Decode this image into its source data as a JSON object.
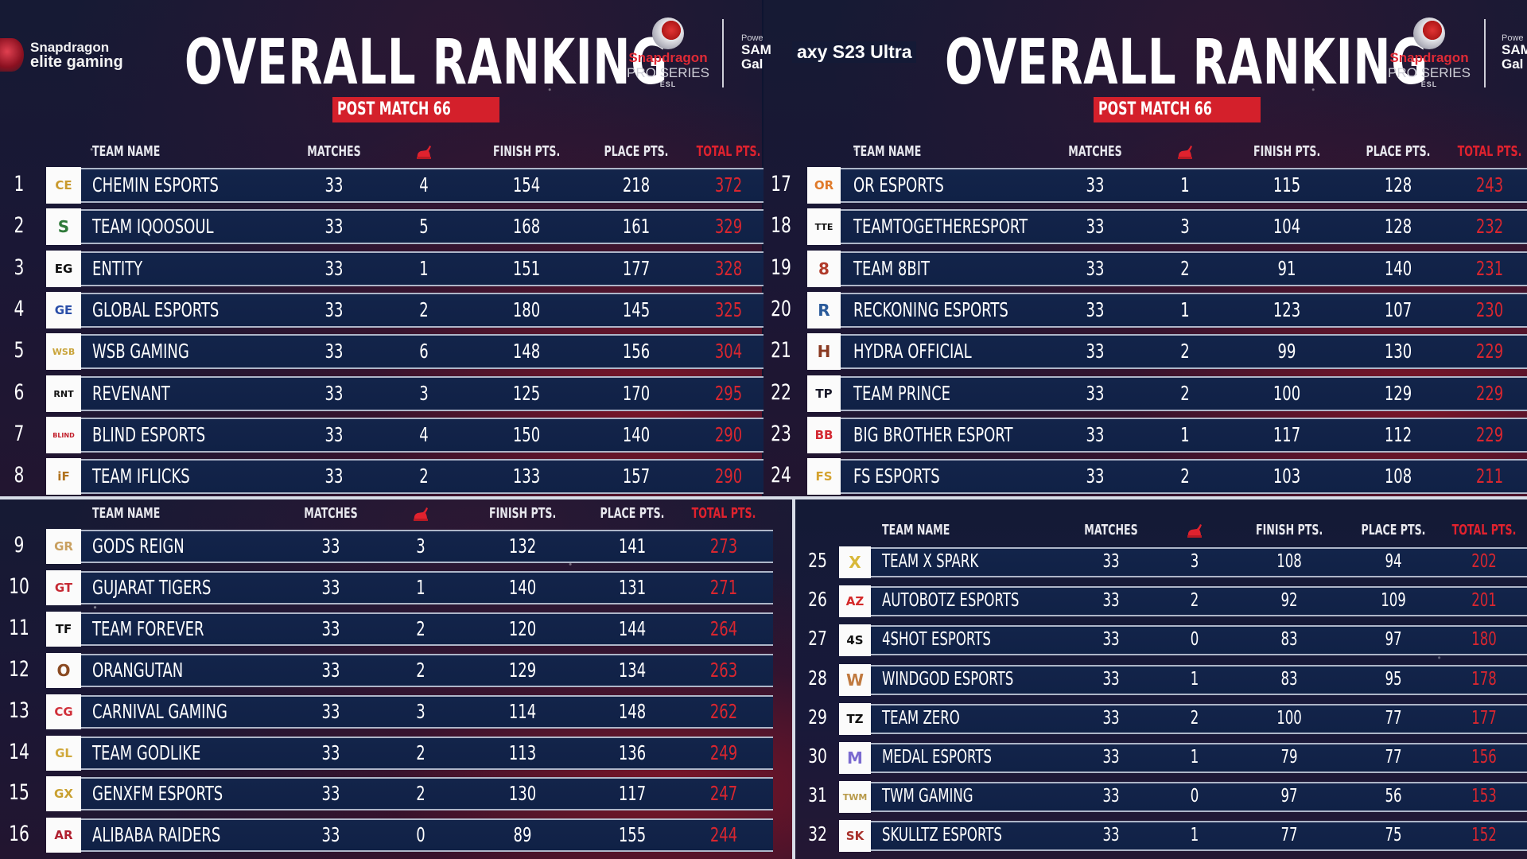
{
  "branding": {
    "left_logo_line1": "Snapdragon",
    "left_logo_line2": "elite gaming",
    "series_line1": "Snapdragon",
    "series_line2": "PRO SERIES",
    "series_line3": "ESL",
    "powered_by": "Powe",
    "powered_brand_l1": "SAM",
    "powered_brand_l2": "Gal",
    "overlay_text": "axy S23 Ultra",
    "colors": {
      "accent_red": "#d4202b",
      "row_bar": "#13244a",
      "background": "#161a34"
    }
  },
  "panels": [
    {
      "title": "OVERALL RANKING",
      "subtitle": "POST MATCH 66"
    },
    {
      "title": "OVERALL RANKING",
      "subtitle": "POST MATCH 66"
    }
  ],
  "columns": {
    "team_name": "TEAM NAME",
    "matches": "MATCHES",
    "wins_icon": "chicken-dinner-icon",
    "finish_pts": "FINISH PTS.",
    "place_pts": "PLACE PTS.",
    "total_pts": "TOTAL PTS."
  },
  "tables": [
    {
      "rows": [
        {
          "rank": "1",
          "team": "CHEMIN ESPORTS",
          "logo": "CE",
          "logo_color": "#c99a2e",
          "matches": "33",
          "wins": "4",
          "finish": "154",
          "place": "218",
          "total": "372"
        },
        {
          "rank": "2",
          "team": "TEAM IQOOSOUL",
          "logo": "S",
          "logo_color": "#2f7a3a",
          "matches": "33",
          "wins": "5",
          "finish": "168",
          "place": "161",
          "total": "329"
        },
        {
          "rank": "3",
          "team": "ENTITY",
          "logo": "EG",
          "logo_color": "#111111",
          "matches": "33",
          "wins": "1",
          "finish": "151",
          "place": "177",
          "total": "328"
        },
        {
          "rank": "4",
          "team": "GLOBAL ESPORTS",
          "logo": "GE",
          "logo_color": "#2a4ea8",
          "matches": "33",
          "wins": "2",
          "finish": "180",
          "place": "145",
          "total": "325"
        },
        {
          "rank": "5",
          "team": "WSB GAMING",
          "logo": "WSB",
          "logo_color": "#c9a43a",
          "matches": "33",
          "wins": "6",
          "finish": "148",
          "place": "156",
          "total": "304"
        },
        {
          "rank": "6",
          "team": "REVENANT",
          "logo": "RNT",
          "logo_color": "#111111",
          "matches": "33",
          "wins": "3",
          "finish": "125",
          "place": "170",
          "total": "295"
        },
        {
          "rank": "7",
          "team": "BLIND ESPORTS",
          "logo": "BLIND",
          "logo_color": "#c21e2a",
          "matches": "33",
          "wins": "4",
          "finish": "150",
          "place": "140",
          "total": "290"
        },
        {
          "rank": "8",
          "team": "TEAM IFLICKS",
          "logo": "iF",
          "logo_color": "#b0721e",
          "matches": "33",
          "wins": "2",
          "finish": "133",
          "place": "157",
          "total": "290"
        }
      ]
    },
    {
      "rows": [
        {
          "rank": "17",
          "team": "OR ESPORTS",
          "logo": "OR",
          "logo_color": "#e07a2a",
          "matches": "33",
          "wins": "1",
          "finish": "115",
          "place": "128",
          "total": "243"
        },
        {
          "rank": "18",
          "team": "TEAMTOGETHERESPORT",
          "logo": "TTE",
          "logo_color": "#111111",
          "matches": "33",
          "wins": "3",
          "finish": "104",
          "place": "128",
          "total": "232"
        },
        {
          "rank": "19",
          "team": "TEAM 8BIT",
          "logo": "8",
          "logo_color": "#b03a2a",
          "matches": "33",
          "wins": "2",
          "finish": "91",
          "place": "140",
          "total": "231"
        },
        {
          "rank": "20",
          "team": "RECKONING ESPORTS",
          "logo": "R",
          "logo_color": "#2a5a9a",
          "matches": "33",
          "wins": "1",
          "finish": "123",
          "place": "107",
          "total": "230"
        },
        {
          "rank": "21",
          "team": "HYDRA OFFICIAL",
          "logo": "H",
          "logo_color": "#8a3a22",
          "matches": "33",
          "wins": "2",
          "finish": "99",
          "place": "130",
          "total": "229"
        },
        {
          "rank": "22",
          "team": "TEAM PRINCE",
          "logo": "TP",
          "logo_color": "#1a1a2a",
          "matches": "33",
          "wins": "2",
          "finish": "100",
          "place": "129",
          "total": "229"
        },
        {
          "rank": "23",
          "team": "BIG BROTHER ESPORT",
          "logo": "BB",
          "logo_color": "#d42a34",
          "matches": "33",
          "wins": "1",
          "finish": "117",
          "place": "112",
          "total": "229"
        },
        {
          "rank": "24",
          "team": "FS ESPORTS",
          "logo": "FS",
          "logo_color": "#d4a22e",
          "matches": "33",
          "wins": "2",
          "finish": "103",
          "place": "108",
          "total": "211"
        }
      ]
    },
    {
      "rows": [
        {
          "rank": "9",
          "team": "GODS REIGN",
          "logo": "GR",
          "logo_color": "#c9a060",
          "matches": "33",
          "wins": "3",
          "finish": "132",
          "place": "141",
          "total": "273"
        },
        {
          "rank": "10",
          "team": "GUJARAT TIGERS",
          "logo": "GT",
          "logo_color": "#c62a34",
          "matches": "33",
          "wins": "1",
          "finish": "140",
          "place": "131",
          "total": "271"
        },
        {
          "rank": "11",
          "team": "TEAM FOREVER",
          "logo": "TF",
          "logo_color": "#111111",
          "matches": "33",
          "wins": "2",
          "finish": "120",
          "place": "144",
          "total": "264"
        },
        {
          "rank": "12",
          "team": "ORANGUTAN",
          "logo": "O",
          "logo_color": "#8a4a22",
          "matches": "33",
          "wins": "2",
          "finish": "129",
          "place": "134",
          "total": "263"
        },
        {
          "rank": "13",
          "team": "CARNIVAL GAMING",
          "logo": "CG",
          "logo_color": "#d0303a",
          "matches": "33",
          "wins": "3",
          "finish": "114",
          "place": "148",
          "total": "262"
        },
        {
          "rank": "14",
          "team": "TEAM GODLIKE",
          "logo": "GL",
          "logo_color": "#d0a83a",
          "matches": "33",
          "wins": "2",
          "finish": "113",
          "place": "136",
          "total": "249"
        },
        {
          "rank": "15",
          "team": "GENXFM ESPORTS",
          "logo": "GX",
          "logo_color": "#c9a030",
          "matches": "33",
          "wins": "2",
          "finish": "130",
          "place": "117",
          "total": "247"
        },
        {
          "rank": "16",
          "team": "ALIBABA RAIDERS",
          "logo": "AR",
          "logo_color": "#b02030",
          "matches": "33",
          "wins": "0",
          "finish": "89",
          "place": "155",
          "total": "244"
        }
      ]
    },
    {
      "rows": [
        {
          "rank": "25",
          "team": "TEAM X SPARK",
          "logo": "X",
          "logo_color": "#d8b83a",
          "matches": "33",
          "wins": "3",
          "finish": "108",
          "place": "94",
          "total": "202"
        },
        {
          "rank": "26",
          "team": "AUTOBOTZ ESPORTS",
          "logo": "AZ",
          "logo_color": "#d42a2a",
          "matches": "33",
          "wins": "2",
          "finish": "92",
          "place": "109",
          "total": "201"
        },
        {
          "rank": "27",
          "team": "4SHOT ESPORTS",
          "logo": "4S",
          "logo_color": "#111111",
          "matches": "33",
          "wins": "0",
          "finish": "83",
          "place": "97",
          "total": "180"
        },
        {
          "rank": "28",
          "team": "WINDGOD ESPORTS",
          "logo": "W",
          "logo_color": "#c07a40",
          "matches": "33",
          "wins": "1",
          "finish": "83",
          "place": "95",
          "total": "178"
        },
        {
          "rank": "29",
          "team": "TEAM ZERO",
          "logo": "TZ",
          "logo_color": "#111111",
          "matches": "33",
          "wins": "2",
          "finish": "100",
          "place": "77",
          "total": "177"
        },
        {
          "rank": "30",
          "team": "MEDAL ESPORTS",
          "logo": "M",
          "logo_color": "#7a6ad0",
          "matches": "33",
          "wins": "1",
          "finish": "79",
          "place": "77",
          "total": "156"
        },
        {
          "rank": "31",
          "team": "TWM GAMING",
          "logo": "TWM",
          "logo_color": "#b89a4a",
          "matches": "33",
          "wins": "0",
          "finish": "97",
          "place": "56",
          "total": "153"
        },
        {
          "rank": "32",
          "team": "SKULLTZ ESPORTS",
          "logo": "SK",
          "logo_color": "#a8302a",
          "matches": "33",
          "wins": "1",
          "finish": "77",
          "place": "75",
          "total": "152"
        }
      ]
    }
  ]
}
